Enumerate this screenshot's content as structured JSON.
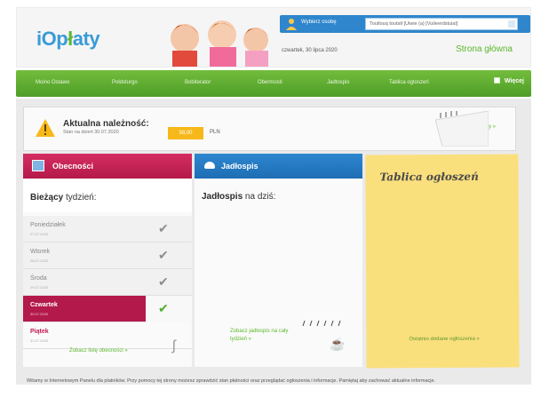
{
  "header": {
    "logo": "iOpłaty",
    "user_bar": {
      "select_child_label": "Wybierz osobę",
      "selected_value": "Toutlouq toutstł [Uiwie (a) [Vuileerdstuiaï]"
    },
    "date": "czwartek, 30 lipca 2020",
    "home_link": "Strona główna"
  },
  "nav": {
    "items": [
      "Moino Ostawo",
      "Poldsturgo",
      "Bobiterator",
      "Obermosti",
      "Jadtospis",
      "Tablica ogtoszeń"
    ],
    "more_label": "Więcej"
  },
  "dues": {
    "title": "Aktualna należność:",
    "subtitle": "Stan na dzień 30.07.2020",
    "amount": "58,00",
    "currency": "PLN",
    "details_link": "Zobacz szczegóły »"
  },
  "attendance": {
    "title": "Obecności",
    "week_bold": "Bieżący",
    "week_rest": " tydzień:",
    "days": [
      {
        "name": "Poniedziałek",
        "date": "27.07.2020",
        "check": "✔"
      },
      {
        "name": "Wtorek",
        "date": "28.07.2020",
        "check": "✔"
      },
      {
        "name": "Środa",
        "date": "29.07.2020",
        "check": "✔"
      },
      {
        "name": "Czwartek",
        "date": "30.07.2020",
        "check": "✔"
      },
      {
        "name": "Piątek",
        "date": "31.07.2020",
        "check": ""
      }
    ],
    "link": "Zobacz listę obecności »"
  },
  "menu": {
    "title": "Jadłospis",
    "today_bold": "Jadłospis",
    "today_rest": " na dziś:",
    "link": "Zobacz jadłospis na cały tydzień »"
  },
  "board": {
    "title": "Tablica ogłoszeń",
    "link": "Ostatnio dodane ogłoszenia »"
  },
  "footer": {
    "text": "Witamy w Internetowym Panelu dla platników. Przy pomocy tej strony możesz sprawdzić stan płatności oraz przeglądać ogłoszenia i informacje. Pamiętaj aby zachować aktualne informacje."
  },
  "colors": {
    "brand_blue": "#3a9bd7",
    "brand_green": "#5cb82c",
    "attendance_red": "#c2194f",
    "menu_blue": "#2e87cf",
    "board_yellow": "#fadf7d",
    "amount_orange": "#f6b81a"
  }
}
